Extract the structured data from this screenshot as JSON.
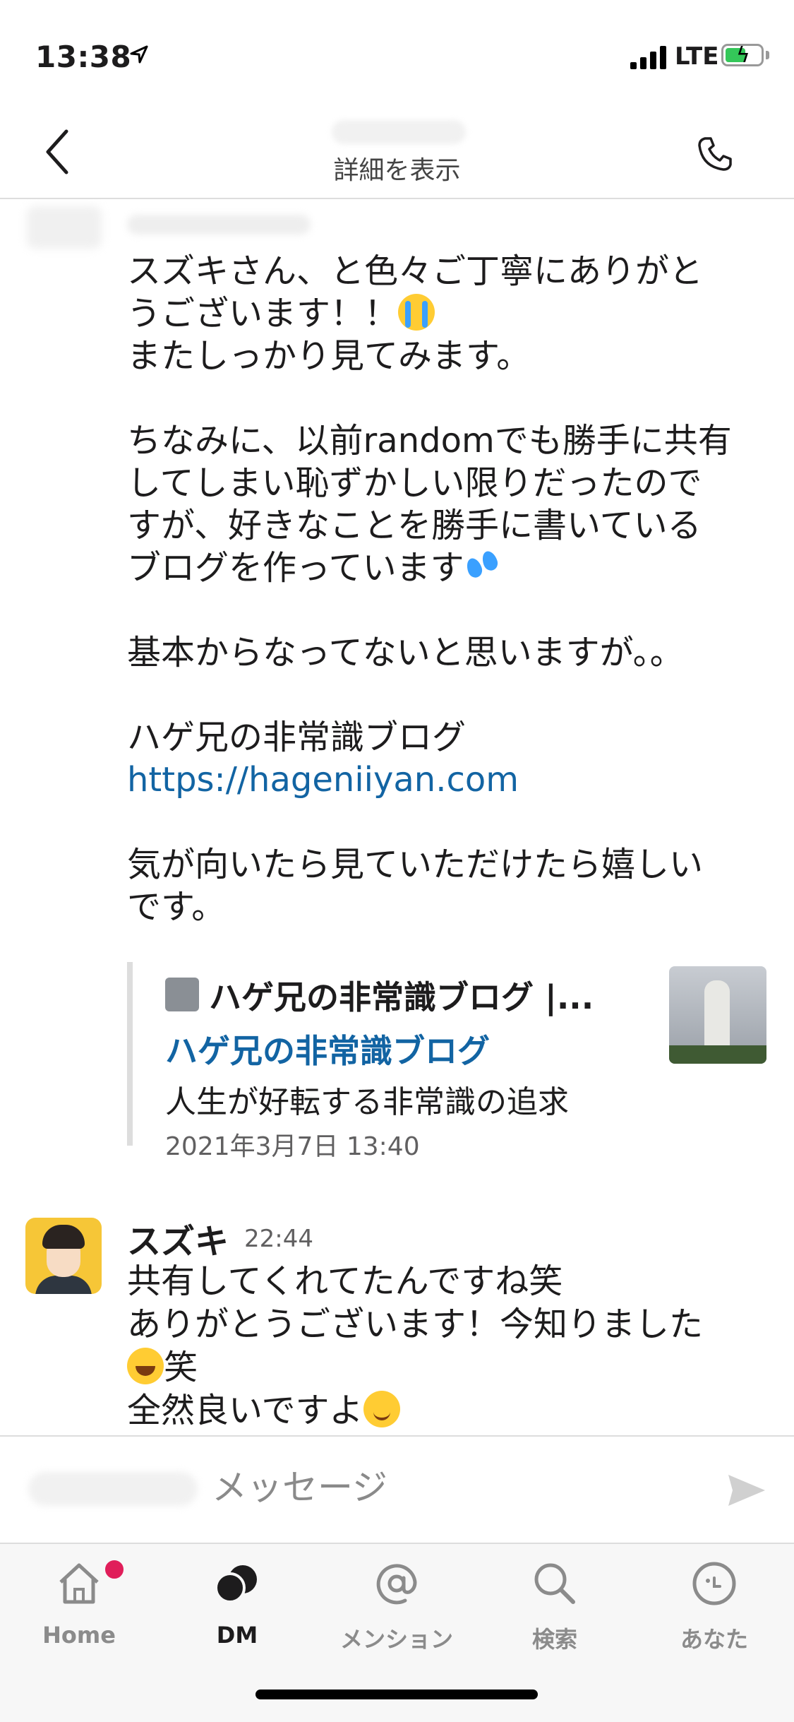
{
  "status_bar": {
    "time": "13:38",
    "network": "LTE"
  },
  "header": {
    "subtitle": "詳細を表示"
  },
  "message1": {
    "lines": [
      "スズキさん、と色々ご丁寧にありがと",
      "うございます！！",
      "またしっかり見てみます。",
      "",
      "ちなみに、以前randomでも勝手に共有",
      "してしまい恥ずかしい限りだったので",
      "すが、好きなことを勝手に書いている",
      "ブログを作っています",
      "",
      "基本からなってないと思いますが。。",
      "",
      "ハゲ兄の非常識ブログ",
      "https://hageniiyan.com",
      "",
      "気が向いたら見ていただけたら嬉しい",
      "です。"
    ],
    "emojis": [
      "loudly-crying-face",
      "sweat-droplets"
    ]
  },
  "link_preview": {
    "site_name": "ハゲ兄の非常識ブログ |...",
    "title": "ハゲ兄の非常識ブログ",
    "description": "人生が好転する非常識の追求",
    "date": "2021年3月7日 13:40"
  },
  "message2": {
    "sender": "スズキ",
    "time": "22:44",
    "lines": [
      "共有してくれてたんですね笑",
      "ありがとうございます！今知りました",
      "笑",
      "全然良いですよ"
    ],
    "emojis": [
      "grinning-squinting-face",
      "smiling-face"
    ]
  },
  "composer": {
    "placeholder": "メッセージ"
  },
  "tabs": [
    {
      "label": "Home",
      "icon": "home-icon",
      "active": false,
      "badge": true
    },
    {
      "label": "DM",
      "icon": "dm-icon",
      "active": true,
      "badge": false
    },
    {
      "label": "メンション",
      "icon": "at-icon",
      "active": false,
      "badge": false
    },
    {
      "label": "検索",
      "icon": "search-icon",
      "active": false,
      "badge": false
    },
    {
      "label": "あなた",
      "icon": "you-icon",
      "active": false,
      "badge": false
    }
  ],
  "colors": {
    "link": "#1264a3",
    "badge": "#e01e5a",
    "text": "#1d1c1d"
  }
}
